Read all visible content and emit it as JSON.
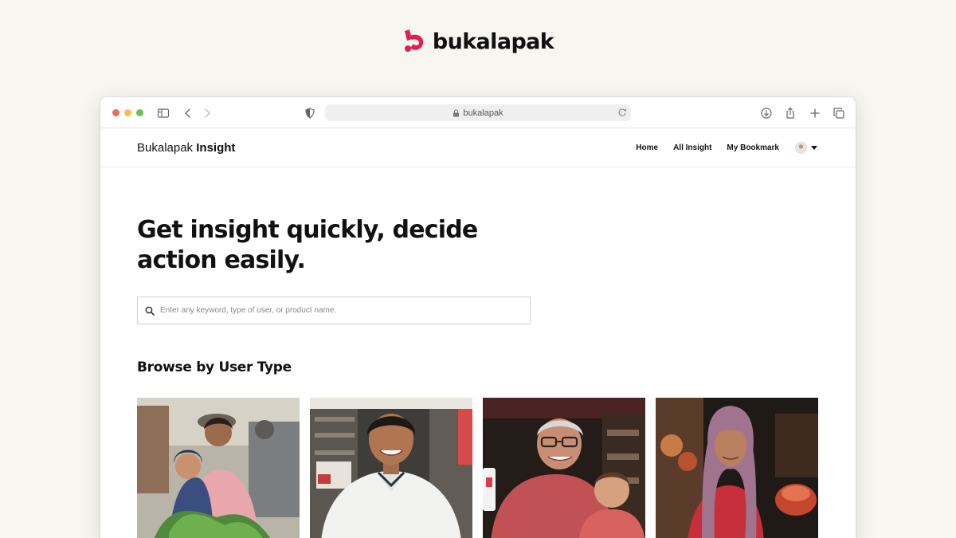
{
  "brand": {
    "name": "bukalapak",
    "color": "#e31e52"
  },
  "browser": {
    "url": "bukalapak",
    "icons": [
      "sidebar-icon",
      "back-icon",
      "forward-icon",
      "shield-icon",
      "lock-icon",
      "reload-icon",
      "download-icon",
      "share-icon",
      "new-tab-icon",
      "tabs-icon"
    ]
  },
  "site": {
    "brand_prefix": "Bukalapak",
    "brand_suffix": "Insight",
    "nav": {
      "home": "Home",
      "all_insight": "All Insight",
      "my_bookmark": "My Bookmark"
    }
  },
  "hero": {
    "title_line1": "Get insight quickly, decide",
    "title_line2": "action easily.",
    "search_placeholder": "Enter any keyword, type of user, or product name."
  },
  "browse": {
    "title": "Browse by User Type",
    "cards": [
      {
        "photo": "woman-with-child-at-market"
      },
      {
        "photo": "young-man-in-shop"
      },
      {
        "photo": "grandfather-with-grandchild"
      },
      {
        "photo": "woman-in-hijab-at-market"
      }
    ]
  }
}
